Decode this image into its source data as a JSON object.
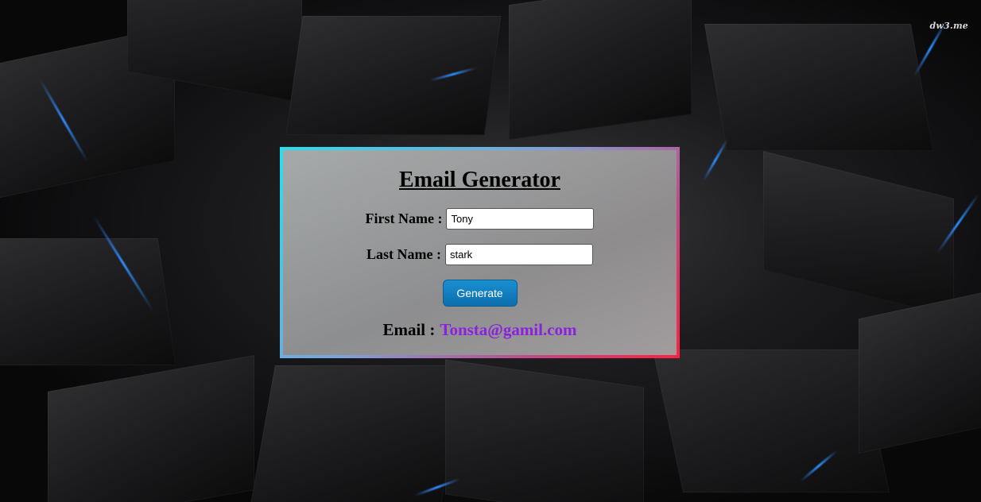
{
  "watermark": "dw3.me",
  "form": {
    "title": "Email Generator",
    "first_name_label": "First Name :",
    "first_name_value": "Tony",
    "last_name_label": "Last Name :",
    "last_name_value": "stark",
    "generate_label": "Generate",
    "email_label": "Email :",
    "email_value": "Tonsta@gamil.com"
  },
  "colors": {
    "border_gradient": [
      "#26e0ee",
      "#ff2040"
    ],
    "button": "#0b76b8",
    "email_value": "#8a22dd",
    "background": "#0a0a0c"
  }
}
